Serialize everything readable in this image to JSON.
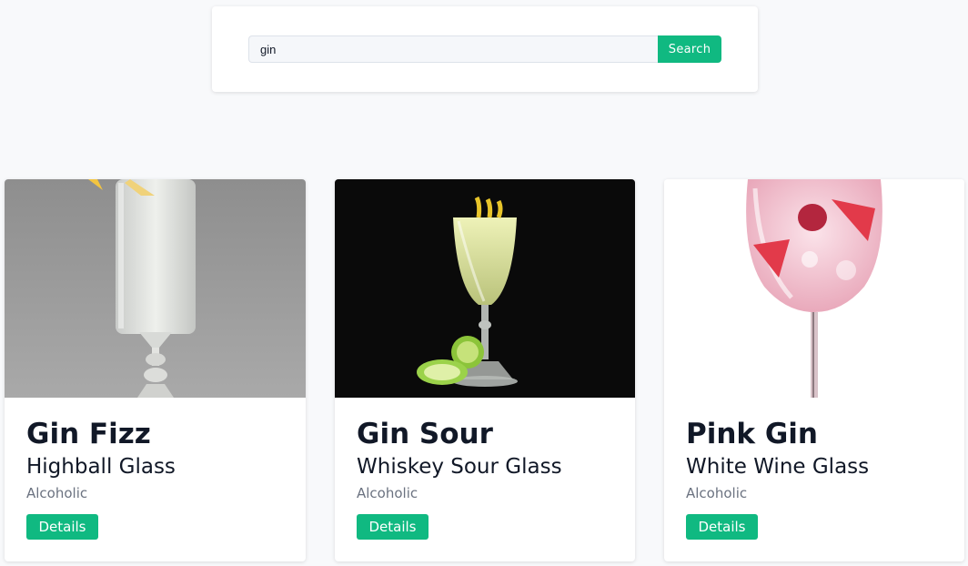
{
  "search": {
    "value": "gin",
    "button_label": "Search"
  },
  "colors": {
    "accent": "#10b981",
    "page_background": "#f8f9fb"
  },
  "drinks": [
    {
      "name": "Gin Fizz",
      "glass": "Highball Glass",
      "category": "Alcoholic",
      "details_label": "Details",
      "image": "cocktail-photo-gin-fizz"
    },
    {
      "name": "Gin Sour",
      "glass": "Whiskey Sour Glass",
      "category": "Alcoholic",
      "details_label": "Details",
      "image": "cocktail-photo-gin-sour"
    },
    {
      "name": "Pink Gin",
      "glass": "White Wine Glass",
      "category": "Alcoholic",
      "details_label": "Details",
      "image": "cocktail-photo-pink-gin"
    }
  ]
}
